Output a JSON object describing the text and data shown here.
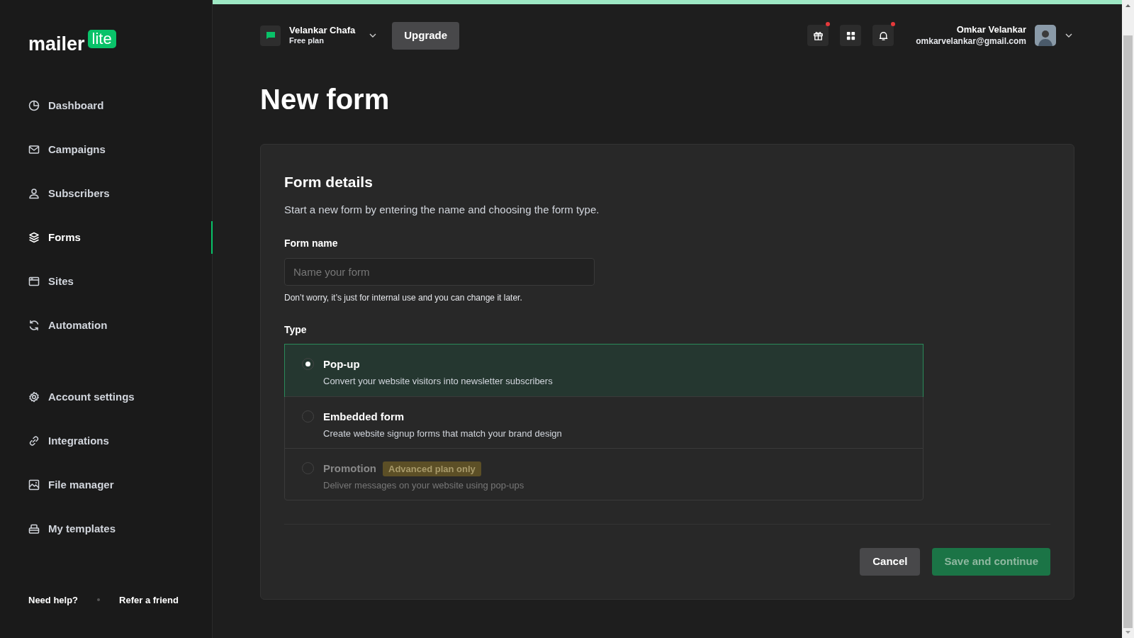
{
  "sidebar": {
    "logo": {
      "word": "mailer",
      "badge": "lite"
    },
    "items": [
      {
        "label": "Dashboard",
        "selected": false
      },
      {
        "label": "Campaigns",
        "selected": false
      },
      {
        "label": "Subscribers",
        "selected": false
      },
      {
        "label": "Forms",
        "selected": true
      },
      {
        "label": "Sites",
        "selected": false
      },
      {
        "label": "Automation",
        "selected": false
      }
    ],
    "secondary_items": [
      {
        "label": "Account settings",
        "selected": false
      },
      {
        "label": "Integrations",
        "selected": false
      },
      {
        "label": "File manager",
        "selected": false
      },
      {
        "label": "My templates",
        "selected": false
      }
    ],
    "footer_links": [
      "Need help?",
      "Refer a friend"
    ]
  },
  "header": {
    "workspace": {
      "name": "Velankar Chafa",
      "plan": "Free plan"
    },
    "upgrade_button": "Upgrade",
    "icons": [
      {
        "notification": true
      },
      {
        "notification": false
      },
      {
        "notification": true
      }
    ],
    "user": {
      "name": "Omkar Velankar",
      "email": "omkarvelankar@gmail.com"
    }
  },
  "page_title": "New form",
  "card": {
    "heading": "Form details",
    "description": "Start a new form by entering the name and choosing the form type.",
    "form_name": {
      "label": "Form name",
      "placeholder": "Name your form",
      "hint": "Don’t worry, it’s just for internal use and you can change it later."
    },
    "type_label": "Type",
    "options": [
      {
        "title": "Pop-up",
        "description": "Convert your website visitors into newsletter subscribers",
        "selected": true,
        "disabled": false
      },
      {
        "title": "Embedded form",
        "description": "Create website signup forms that match your brand design",
        "selected": false,
        "disabled": false
      },
      {
        "title": "Promotion",
        "badge": "Advanced plan only",
        "description": "Deliver messages on your website using pop-ups",
        "selected": false,
        "disabled": true
      }
    ],
    "cancel_button": "Cancel",
    "save_button": {
      "label": "Save and continue",
      "disabled": true
    }
  }
}
